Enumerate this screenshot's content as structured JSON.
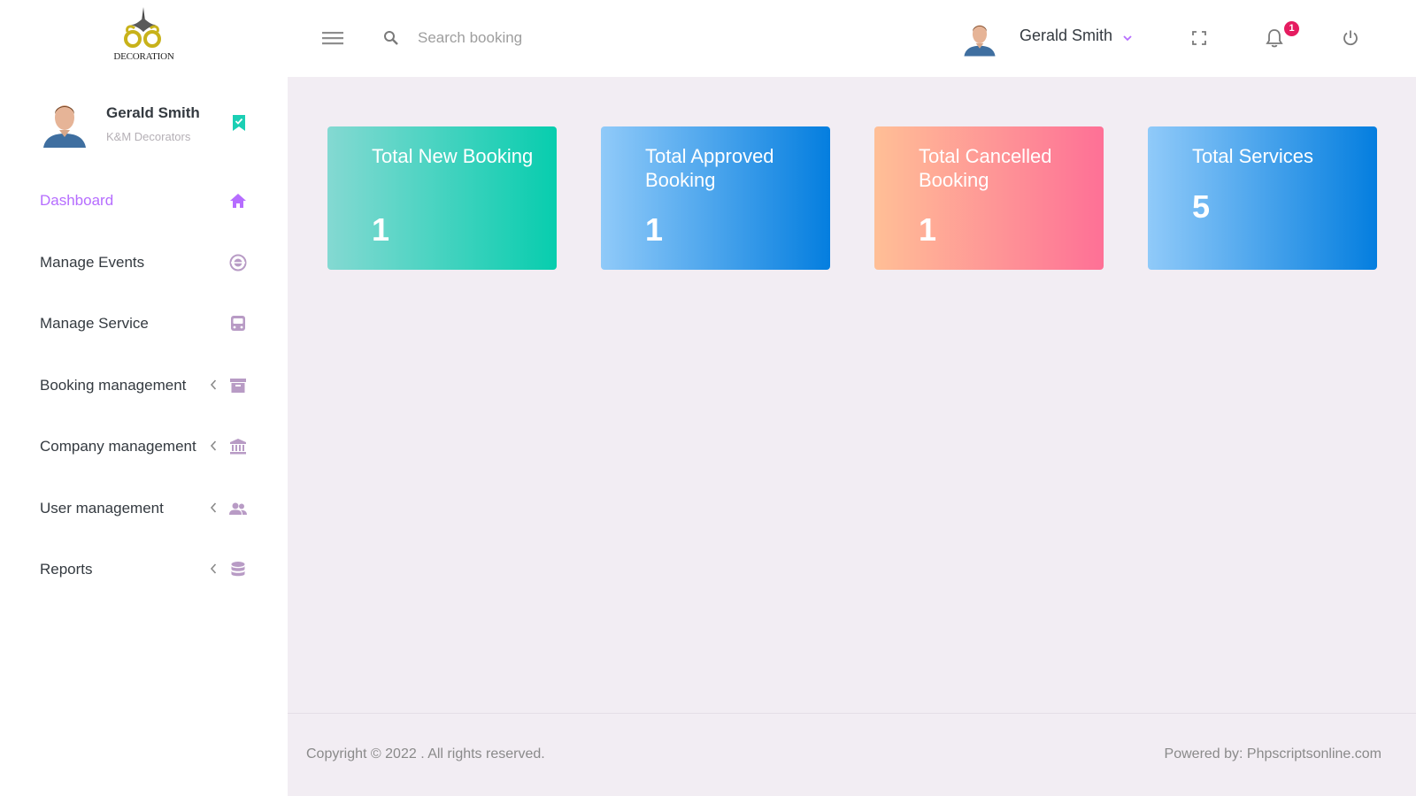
{
  "brand": {
    "logo_text": "DECORATION"
  },
  "sidebar": {
    "profile": {
      "name": "Gerald Smith",
      "company": "K&M Decorators"
    },
    "items": [
      {
        "label": "Dashboard",
        "icon": "home-icon",
        "active": true,
        "submenu": false
      },
      {
        "label": "Manage Events",
        "icon": "target-icon",
        "active": false,
        "submenu": false
      },
      {
        "label": "Manage Service",
        "icon": "bus-icon",
        "active": false,
        "submenu": false
      },
      {
        "label": "Booking management",
        "icon": "archive-icon",
        "active": false,
        "submenu": true
      },
      {
        "label": "Company management",
        "icon": "bank-icon",
        "active": false,
        "submenu": true
      },
      {
        "label": "User management",
        "icon": "users-icon",
        "active": false,
        "submenu": true
      },
      {
        "label": "Reports",
        "icon": "database-icon",
        "active": false,
        "submenu": true
      }
    ]
  },
  "header": {
    "search_placeholder": "Search booking",
    "user_name": "Gerald Smith",
    "notification_count": "1"
  },
  "cards": [
    {
      "title": "Total New Booking",
      "value": "1",
      "gradient": [
        "#84d9d2",
        "#07cdae"
      ]
    },
    {
      "title": "Total Approved Booking",
      "value": "1",
      "gradient": [
        "#90caf9",
        "#047edf"
      ]
    },
    {
      "title": "Total Cancelled Booking",
      "value": "1",
      "gradient": [
        "#ffbf96",
        "#fe7096"
      ]
    },
    {
      "title": "Total Services",
      "value": "5",
      "gradient": [
        "#90caf9",
        "#047edf"
      ]
    }
  ],
  "footer": {
    "copyright": "Copyright © 2022 . All rights reserved.",
    "powered_by": "Powered by: Phpscriptsonline.com"
  },
  "colors": {
    "accent": "#b66dff",
    "icon_muted": "#b89bc5",
    "badge": "#e51c60",
    "background": "#f2edf3"
  }
}
